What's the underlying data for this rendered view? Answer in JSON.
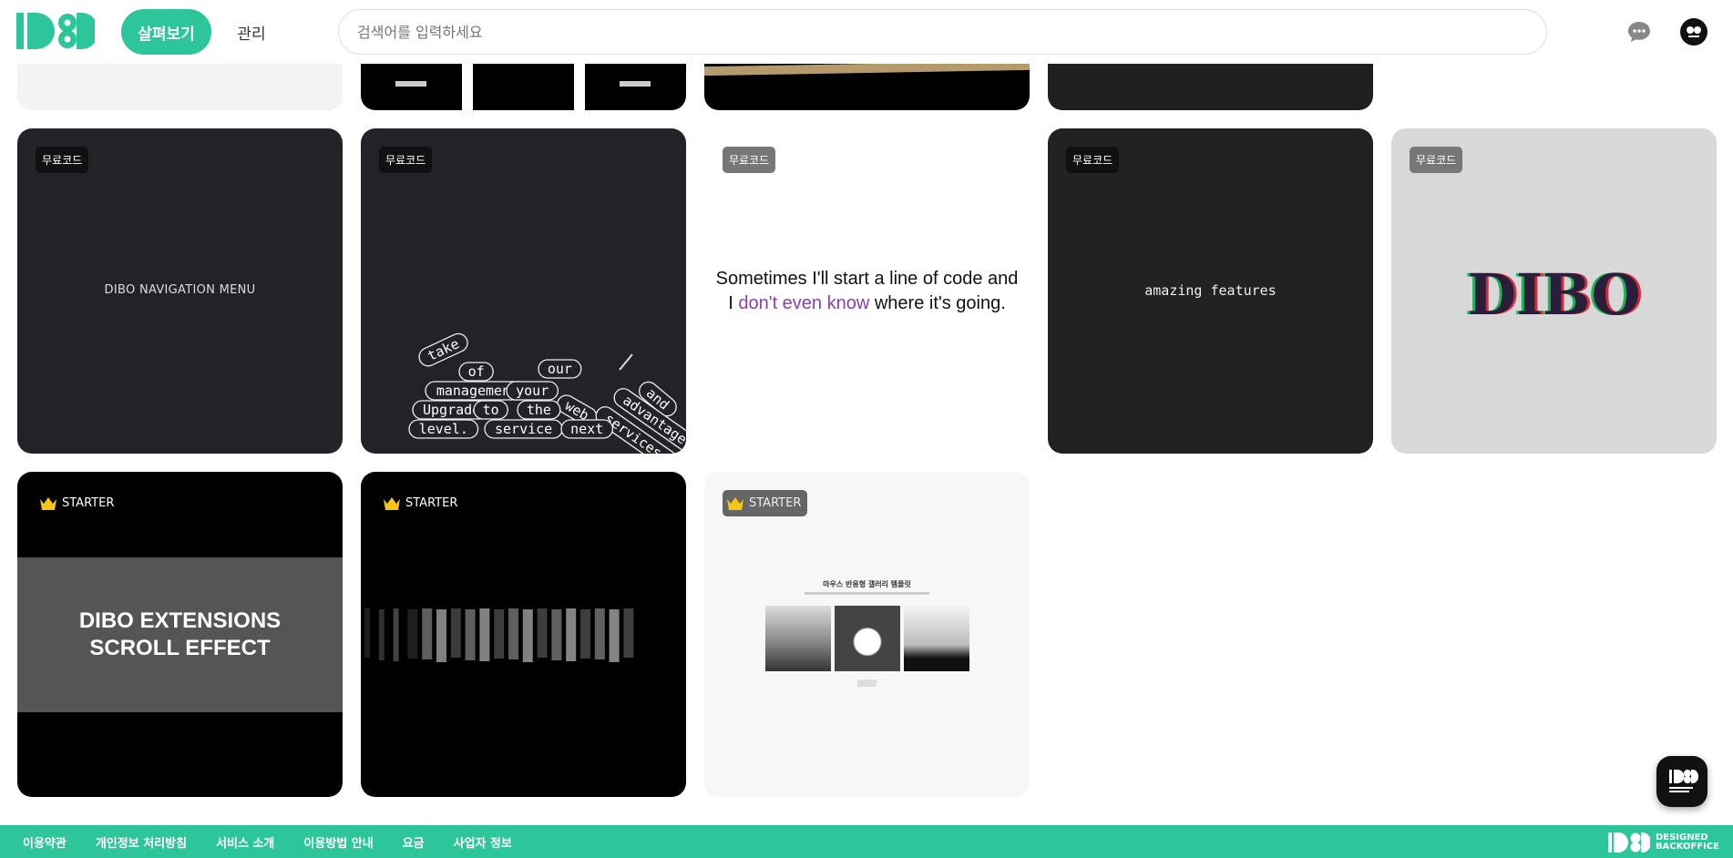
{
  "header": {
    "nav_browse": "살펴보기",
    "nav_manage": "관리",
    "search_placeholder": "검색어를 입력하세요"
  },
  "cards": [
    {
      "badge": "무료코드",
      "text": "DIBO NAVIGATION MENU"
    },
    {
      "badge": "무료코드",
      "pills": [
        "take",
        "of",
        "our",
        "and",
        "management",
        "your",
        "web",
        "advantage",
        "Upgrade",
        "to",
        "the",
        "services.",
        "level.",
        "service",
        "next"
      ]
    },
    {
      "badge": "무료코드",
      "line1": "Sometimes I'll start a line of code and",
      "line2_pre": "I ",
      "line2_highlight": "don't even know",
      "line2_post": " where it's going."
    },
    {
      "badge": "무료코드",
      "text": "amazing features"
    },
    {
      "badge": "무료코드",
      "text": "DIBO"
    },
    {
      "badge": "STARTER",
      "line1": "DIBO EXTENSIONS",
      "line2": "SCROLL EFFECT"
    },
    {
      "badge": "STARTER"
    },
    {
      "badge": "STARTER",
      "gallery_title": "마우스 반응형 갤러리 템플릿"
    }
  ],
  "footer": {
    "links": [
      "이용약관",
      "개인정보 처리방침",
      "서비스 소개",
      "이용방법 안내",
      "요금",
      "사업자 정보"
    ],
    "logo_line1": "DESIGNED",
    "logo_line2": "BACKOFFICE"
  },
  "colors": {
    "brand": "#2dc59a",
    "highlight": "#8a3fb0"
  },
  "icons": [
    "chat-icon",
    "crown-icon",
    "avatar"
  ]
}
